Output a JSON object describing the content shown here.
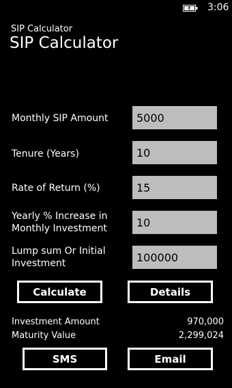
{
  "status": {
    "time": "3:06"
  },
  "header": {
    "app_name": "SIP Calculator",
    "page_title": "SIP Calculator"
  },
  "form": {
    "monthly_sip": {
      "label": "Monthly SIP Amount",
      "value": "5000"
    },
    "tenure": {
      "label": "Tenure (Years)",
      "value": "10"
    },
    "rate": {
      "label": "Rate of Return (%)",
      "value": "15"
    },
    "yearly_increase": {
      "label_line1": "Yearly % Increase in",
      "label_line2": "Monthly Investment",
      "value": "10"
    },
    "lump_sum": {
      "label_line1": "Lump sum Or Initial",
      "label_line2": "Investment",
      "value": "100000"
    }
  },
  "buttons": {
    "calculate": "Calculate",
    "details": "Details",
    "sms": "SMS",
    "email": "Email"
  },
  "results": {
    "investment_amount": {
      "label": "Investment Amount",
      "value": "970,000"
    },
    "maturity_value": {
      "label": "Maturity Value",
      "value": "2,299,024"
    }
  }
}
